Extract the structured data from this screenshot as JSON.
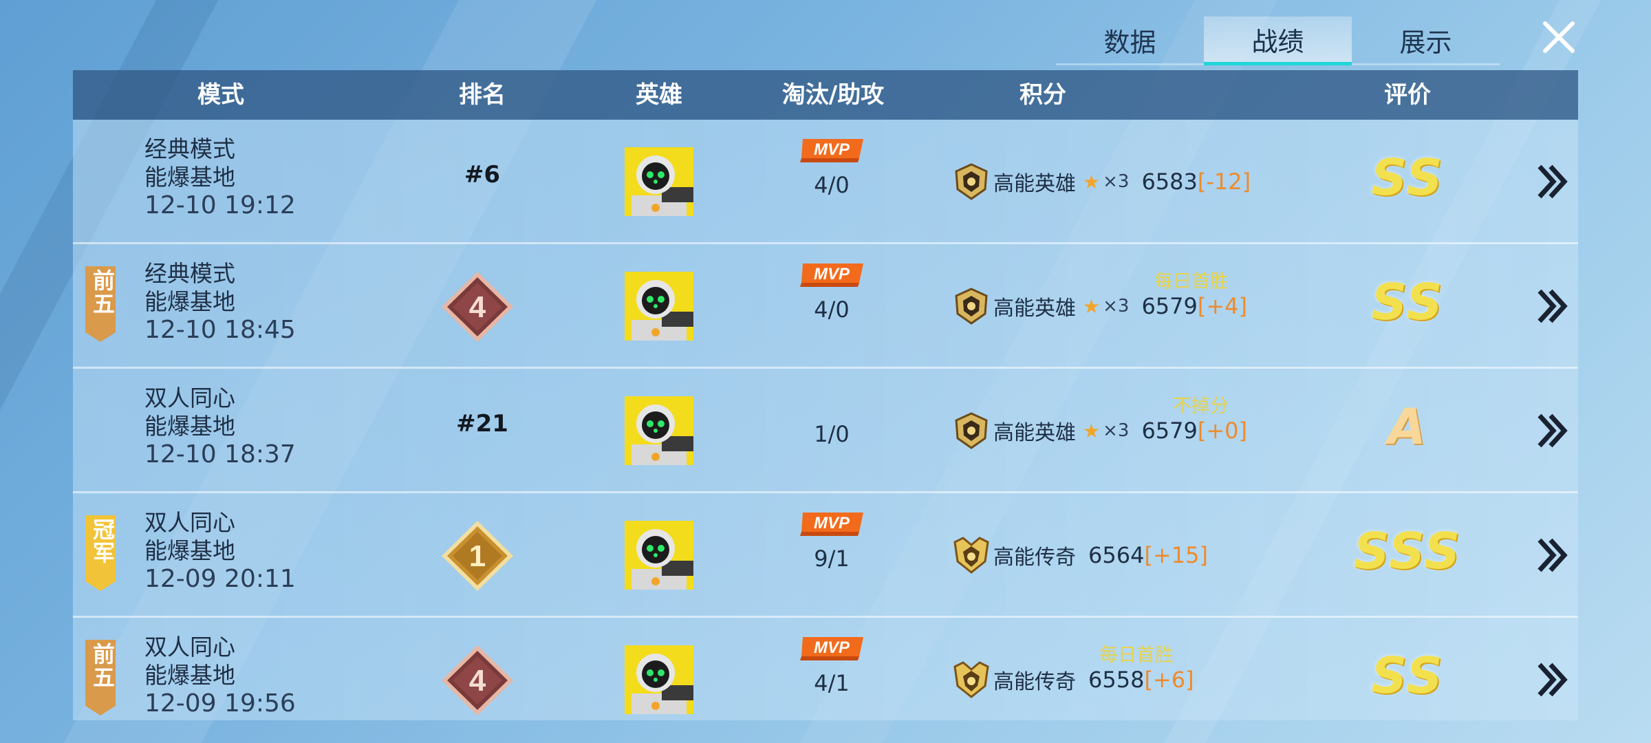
{
  "tabs": [
    {
      "label": "数据",
      "active": false
    },
    {
      "label": "战绩",
      "active": true
    },
    {
      "label": "展示",
      "active": false
    }
  ],
  "table": {
    "headers": {
      "mode": "模式",
      "rank": "排名",
      "hero": "英雄",
      "kda": "淘汰/助攻",
      "score": "积分",
      "rating": "评价"
    },
    "rows": [
      {
        "badge": "",
        "mode": "经典模式",
        "map": "能爆基地",
        "time": "12-10 19:12",
        "rank_text": "#6",
        "rank_number": "",
        "mvp": "MVP",
        "kda": "4/0",
        "bonus": "",
        "tier": "高能英雄",
        "stars": "×3",
        "points": "6583",
        "delta": "[-12]",
        "grade": "SS"
      },
      {
        "badge": "前五",
        "mode": "经典模式",
        "map": "能爆基地",
        "time": "12-10 18:45",
        "rank_text": "",
        "rank_number": "4",
        "mvp": "MVP",
        "kda": "4/0",
        "bonus": "每日首胜",
        "tier": "高能英雄",
        "stars": "×3",
        "points": "6579",
        "delta": "[+4]",
        "grade": "SS"
      },
      {
        "badge": "",
        "mode": "双人同心",
        "map": "能爆基地",
        "time": "12-10 18:37",
        "rank_text": "#21",
        "rank_number": "",
        "mvp": "",
        "kda": "1/0",
        "bonus": "不掉分",
        "tier": "高能英雄",
        "stars": "×3",
        "points": "6579",
        "delta": "[+0]",
        "grade": "A"
      },
      {
        "badge": "冠军",
        "mode": "双人同心",
        "map": "能爆基地",
        "time": "12-09 20:11",
        "rank_text": "",
        "rank_number": "1",
        "mvp": "MVP",
        "kda": "9/1",
        "bonus": "",
        "tier": "高能传奇",
        "stars": "",
        "points": "6564",
        "delta": "[+15]",
        "grade": "SSS"
      },
      {
        "badge": "前五",
        "mode": "双人同心",
        "map": "能爆基地",
        "time": "12-09 19:56",
        "rank_text": "",
        "rank_number": "4",
        "mvp": "MVP",
        "kda": "4/1",
        "bonus": "每日首胜",
        "tier": "高能传奇",
        "stars": "",
        "points": "6558",
        "delta": "[+6]",
        "grade": "SS"
      }
    ]
  },
  "colors": {
    "accent_tab": "#20d6d9",
    "grade_gold": "#f3e04e",
    "delta_orange": "#ef8a2a",
    "bonus_yellow": "#e8d24a",
    "mvp_orange": "#f26a1b",
    "rank_4_plum": "#7a3a3a",
    "rank_1_gold": "#c9902f"
  },
  "icons": {
    "close": "close-icon",
    "detail": "double-chevron-right-icon",
    "tier_hero": "high-energy-hero-emblem-icon",
    "tier_legend": "high-energy-legend-emblem-icon",
    "star": "star-icon"
  }
}
